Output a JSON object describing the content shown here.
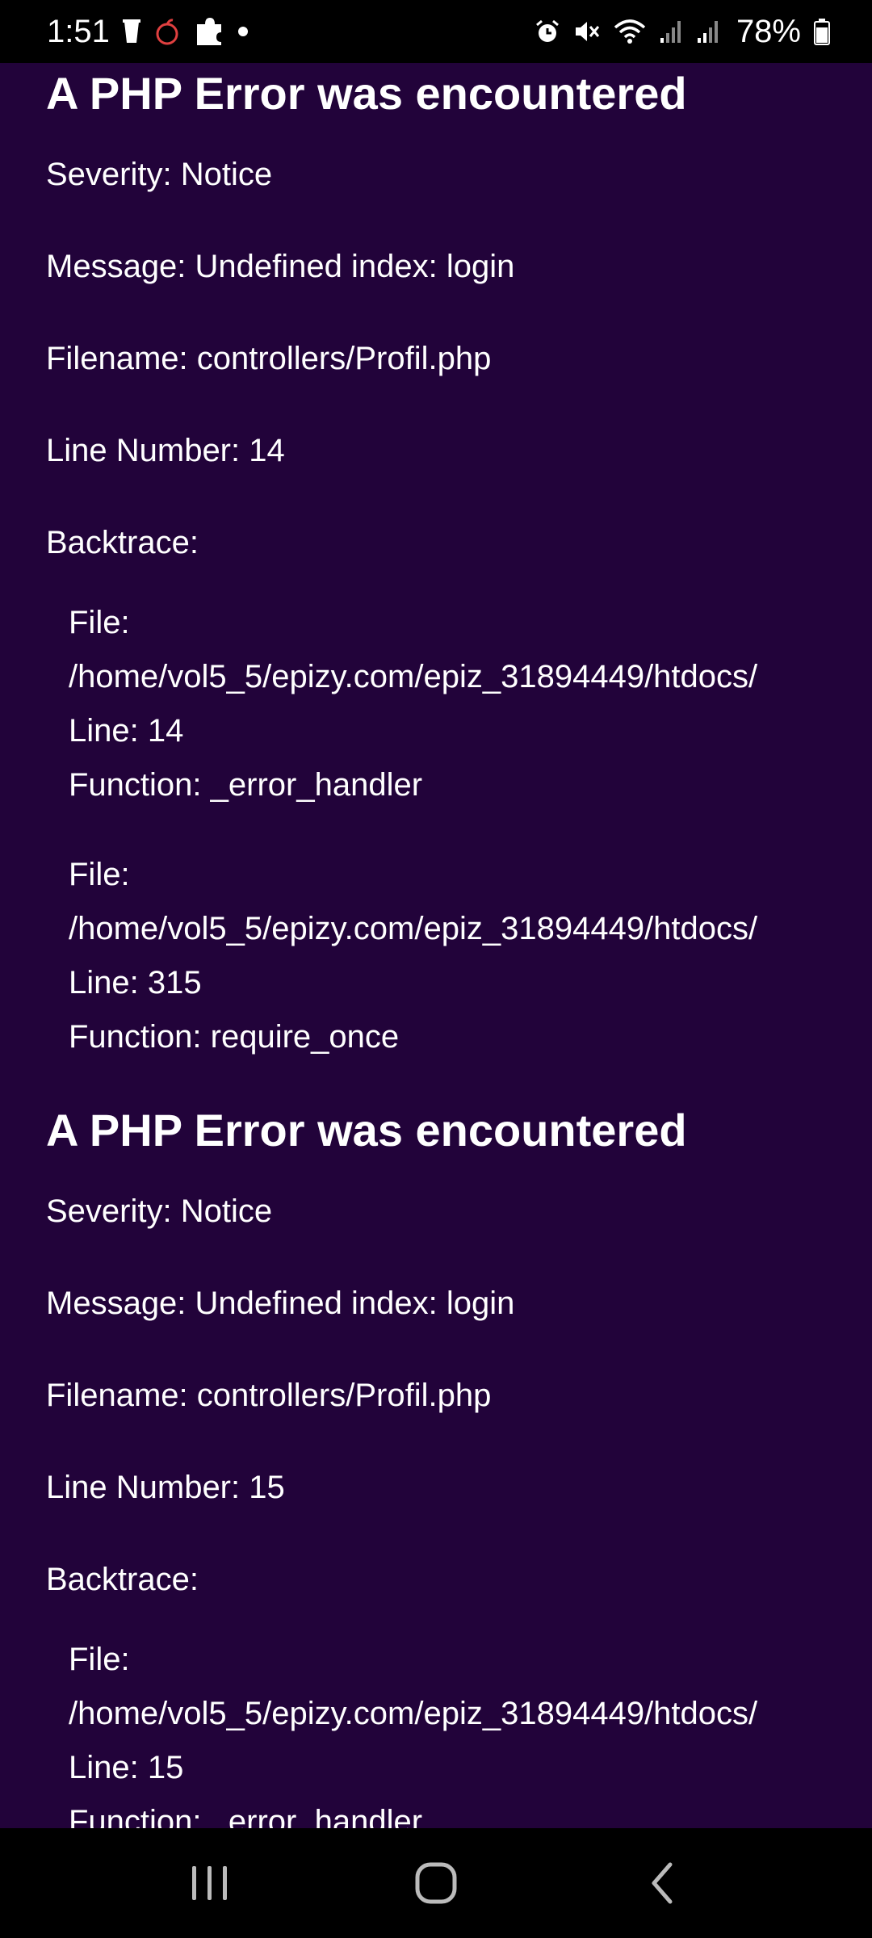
{
  "status_bar": {
    "time": "1:51",
    "battery": "78%",
    "left_icons": [
      "trash-notification-icon",
      "apple-app-icon",
      "puzzle-icon",
      "dot-icon"
    ],
    "right_icons": [
      "alarm-icon",
      "mute-icon",
      "wifi-icon",
      "signal-icon",
      "signal-icon-2",
      "battery-icon"
    ]
  },
  "errors": [
    {
      "title": "A PHP Error was encountered",
      "severity": "Severity: Notice",
      "message": "Message: Undefined index: login",
      "filename": "Filename: controllers/Profil.php",
      "line_number": "Line Number: 14",
      "backtrace_label": "Backtrace:",
      "backtrace": [
        {
          "file_label": "File:",
          "file_path": "/home/vol5_5/epizy.com/epiz_31894449/htdocs/",
          "line": "Line: 14",
          "function": "Function: _error_handler"
        },
        {
          "file_label": "File:",
          "file_path": "/home/vol5_5/epizy.com/epiz_31894449/htdocs/",
          "line": "Line: 315",
          "function": "Function: require_once"
        }
      ]
    },
    {
      "title": "A PHP Error was encountered",
      "severity": "Severity: Notice",
      "message": "Message: Undefined index: login",
      "filename": "Filename: controllers/Profil.php",
      "line_number": "Line Number: 15",
      "backtrace_label": "Backtrace:",
      "backtrace": [
        {
          "file_label": "File:",
          "file_path": "/home/vol5_5/epizy.com/epiz_31894449/htdocs/",
          "line": "Line: 15",
          "function": "Function: _error_handler"
        }
      ]
    }
  ],
  "nav_bar": {
    "buttons": [
      "recent-apps-icon",
      "home-icon",
      "back-icon"
    ]
  },
  "colors": {
    "page_background": "#22033a",
    "bar_background": "#000000",
    "text": "#ffffff"
  }
}
